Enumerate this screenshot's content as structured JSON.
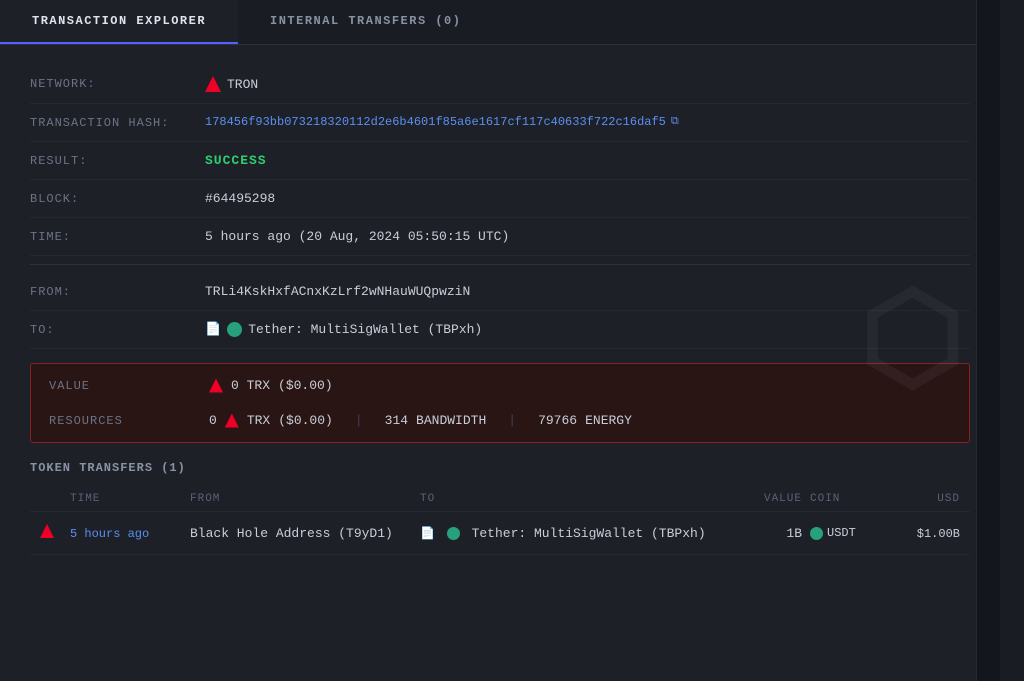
{
  "tabs": [
    {
      "id": "transaction-explorer",
      "label": "TRANSACTION EXPLORER",
      "active": true
    },
    {
      "id": "internal-transfers",
      "label": "INTERNAL TRANSFERS (0)",
      "active": false
    }
  ],
  "transaction": {
    "network_label": "NETWORK:",
    "network_name": "TRON",
    "hash_label": "TRANSACTION HASH:",
    "hash_value": "178456f93bb073218320112d2e6b4601f85a6e1617cf117c40633f722c16daf5",
    "result_label": "RESULT:",
    "result_value": "SUCCESS",
    "block_label": "BLOCK:",
    "block_value": "#64495298",
    "time_label": "TIME:",
    "time_value": "5 hours ago  (20 Aug, 2024 05:50:15 UTC)",
    "from_label": "FROM:",
    "from_value": "TRLi4KskHxfACnxKzLrf2wNHauWUQpwziN",
    "to_label": "TO:",
    "to_value": "Tether: MultiSigWallet (TBPxh)"
  },
  "value_box": {
    "value_label": "VALUE",
    "value_amount": "0 TRX",
    "value_usd": "($0.00)",
    "resources_label": "RESOURCES",
    "resources_trx_amount": "0",
    "resources_trx_label": "TRX",
    "resources_trx_usd": "($0.00)",
    "resources_bandwidth": "314",
    "resources_bandwidth_label": "BANDWIDTH",
    "resources_energy": "79766",
    "resources_energy_label": "ENERGY"
  },
  "token_transfers": {
    "title": "TOKEN TRANSFERS (1)",
    "headers": {
      "link": "",
      "time": "TIME",
      "from": "FROM",
      "to": "TO",
      "value": "VALUE",
      "coin": "COIN",
      "usd": "USD"
    },
    "rows": [
      {
        "time": "5 hours ago",
        "from": "Black Hole Address (T9yD1)",
        "to": "Tether: MultiSigWallet (TBPxh)",
        "value": "1B",
        "coin": "USDT",
        "usd": "$1.00B"
      }
    ]
  }
}
